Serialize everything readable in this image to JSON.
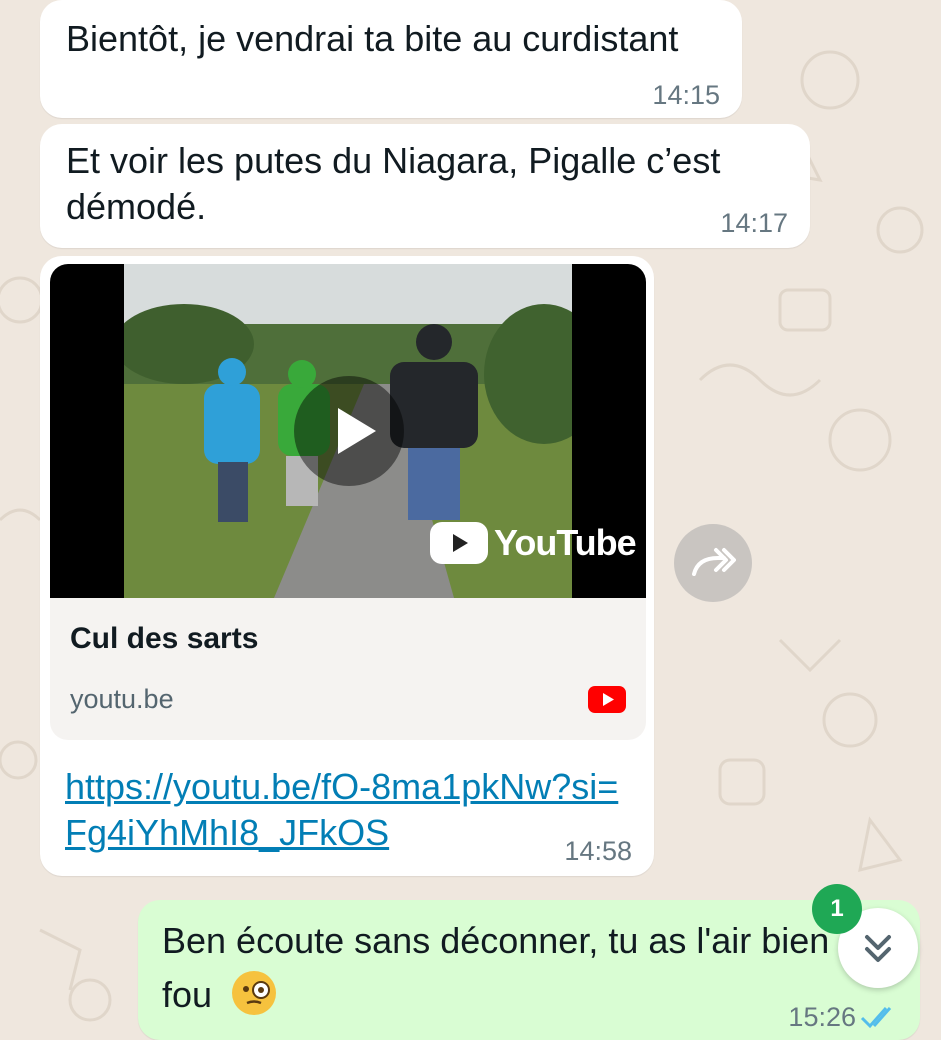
{
  "messages": [
    {
      "text": "Bientôt, je vendrai ta bite au curdistant",
      "time": "14:15"
    },
    {
      "text": "Et voir les putes du Niagara, Pigalle c’est démodé.",
      "time": "14:17"
    },
    {
      "preview": {
        "title": "Cul des sarts",
        "domain": "youtu.be",
        "video_brand": "YouTube"
      },
      "link": "https://youtu.be/fO-8ma1pkNw?si=Fg4iYhMhI8_JFkOS",
      "time": "14:58"
    },
    {
      "text": "Ben écoute sans déconner, tu as l'air bien fou",
      "time": "15:26",
      "emoji": "face-with-monocle"
    }
  ],
  "unread_count": "1",
  "colors": {
    "incoming": "#ffffff",
    "outgoing": "#d9fdd3",
    "link": "#027eb5",
    "badge": "#1fa855",
    "wallpaper": "#efe7de"
  }
}
